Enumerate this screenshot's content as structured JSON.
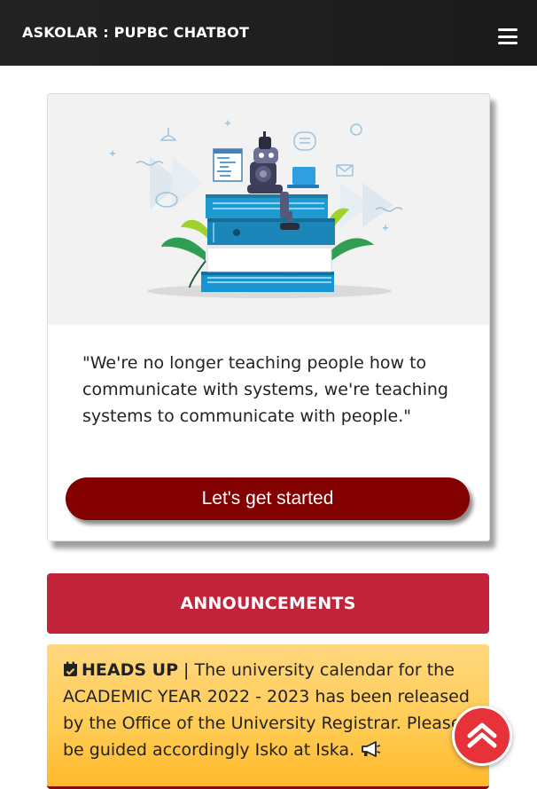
{
  "navbar": {
    "brand": "ASKOLAR : PUPBC CHATBOT",
    "menu_icon": "hamburger-menu-icon"
  },
  "hero": {
    "illustration": "robot-on-books-illustration",
    "quote": "\"We're no longer teaching people how to communicate with systems, we're teaching systems to communicate with people.\"",
    "cta_label": "Let's get started"
  },
  "announcements": {
    "header": "ANNOUNCEMENTS",
    "items": [
      {
        "icon": "calendar-check-icon",
        "label": "HEADS UP",
        "separator": " | ",
        "text": "The university calendar for the ACADEMIC YEAR 2022 - 2023 has been released by the Office of the University Registrar. Please be guided accordingly Isko at Iska.",
        "trailing_icon": "megaphone-icon"
      }
    ]
  },
  "scroll_top": {
    "icon": "chevron-up-icon"
  },
  "colors": {
    "navbar": "#1e1e1e",
    "cta": "#830000",
    "announcement_header": "#c3233a",
    "announcement_card": "#ffcb52",
    "scroll_top": "#e8323a"
  }
}
